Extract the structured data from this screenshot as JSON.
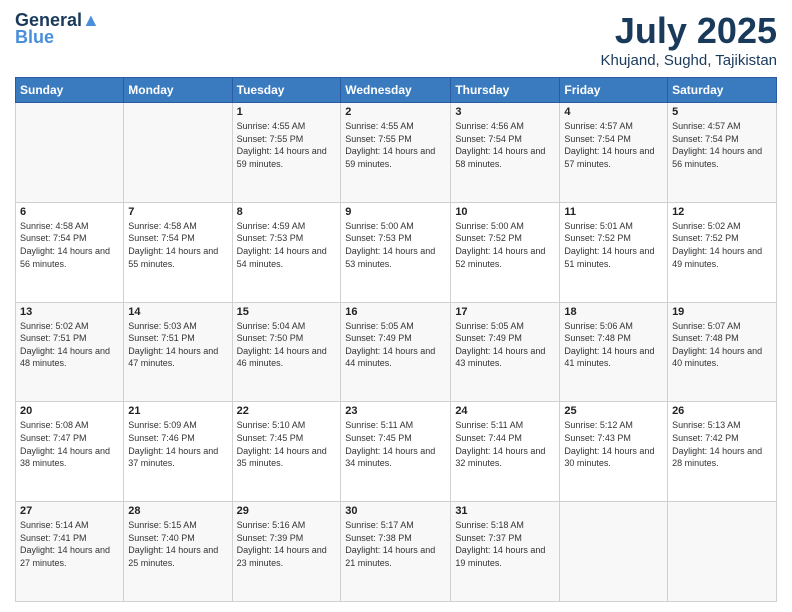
{
  "logo": {
    "general": "General",
    "blue": "Blue"
  },
  "header": {
    "month": "July 2025",
    "location": "Khujand, Sughd, Tajikistan"
  },
  "weekdays": [
    "Sunday",
    "Monday",
    "Tuesday",
    "Wednesday",
    "Thursday",
    "Friday",
    "Saturday"
  ],
  "weeks": [
    [
      {
        "day": "",
        "sunrise": "",
        "sunset": "",
        "daylight": ""
      },
      {
        "day": "",
        "sunrise": "",
        "sunset": "",
        "daylight": ""
      },
      {
        "day": "1",
        "sunrise": "Sunrise: 4:55 AM",
        "sunset": "Sunset: 7:55 PM",
        "daylight": "Daylight: 14 hours and 59 minutes."
      },
      {
        "day": "2",
        "sunrise": "Sunrise: 4:55 AM",
        "sunset": "Sunset: 7:55 PM",
        "daylight": "Daylight: 14 hours and 59 minutes."
      },
      {
        "day": "3",
        "sunrise": "Sunrise: 4:56 AM",
        "sunset": "Sunset: 7:54 PM",
        "daylight": "Daylight: 14 hours and 58 minutes."
      },
      {
        "day": "4",
        "sunrise": "Sunrise: 4:57 AM",
        "sunset": "Sunset: 7:54 PM",
        "daylight": "Daylight: 14 hours and 57 minutes."
      },
      {
        "day": "5",
        "sunrise": "Sunrise: 4:57 AM",
        "sunset": "Sunset: 7:54 PM",
        "daylight": "Daylight: 14 hours and 56 minutes."
      }
    ],
    [
      {
        "day": "6",
        "sunrise": "Sunrise: 4:58 AM",
        "sunset": "Sunset: 7:54 PM",
        "daylight": "Daylight: 14 hours and 56 minutes."
      },
      {
        "day": "7",
        "sunrise": "Sunrise: 4:58 AM",
        "sunset": "Sunset: 7:54 PM",
        "daylight": "Daylight: 14 hours and 55 minutes."
      },
      {
        "day": "8",
        "sunrise": "Sunrise: 4:59 AM",
        "sunset": "Sunset: 7:53 PM",
        "daylight": "Daylight: 14 hours and 54 minutes."
      },
      {
        "day": "9",
        "sunrise": "Sunrise: 5:00 AM",
        "sunset": "Sunset: 7:53 PM",
        "daylight": "Daylight: 14 hours and 53 minutes."
      },
      {
        "day": "10",
        "sunrise": "Sunrise: 5:00 AM",
        "sunset": "Sunset: 7:52 PM",
        "daylight": "Daylight: 14 hours and 52 minutes."
      },
      {
        "day": "11",
        "sunrise": "Sunrise: 5:01 AM",
        "sunset": "Sunset: 7:52 PM",
        "daylight": "Daylight: 14 hours and 51 minutes."
      },
      {
        "day": "12",
        "sunrise": "Sunrise: 5:02 AM",
        "sunset": "Sunset: 7:52 PM",
        "daylight": "Daylight: 14 hours and 49 minutes."
      }
    ],
    [
      {
        "day": "13",
        "sunrise": "Sunrise: 5:02 AM",
        "sunset": "Sunset: 7:51 PM",
        "daylight": "Daylight: 14 hours and 48 minutes."
      },
      {
        "day": "14",
        "sunrise": "Sunrise: 5:03 AM",
        "sunset": "Sunset: 7:51 PM",
        "daylight": "Daylight: 14 hours and 47 minutes."
      },
      {
        "day": "15",
        "sunrise": "Sunrise: 5:04 AM",
        "sunset": "Sunset: 7:50 PM",
        "daylight": "Daylight: 14 hours and 46 minutes."
      },
      {
        "day": "16",
        "sunrise": "Sunrise: 5:05 AM",
        "sunset": "Sunset: 7:49 PM",
        "daylight": "Daylight: 14 hours and 44 minutes."
      },
      {
        "day": "17",
        "sunrise": "Sunrise: 5:05 AM",
        "sunset": "Sunset: 7:49 PM",
        "daylight": "Daylight: 14 hours and 43 minutes."
      },
      {
        "day": "18",
        "sunrise": "Sunrise: 5:06 AM",
        "sunset": "Sunset: 7:48 PM",
        "daylight": "Daylight: 14 hours and 41 minutes."
      },
      {
        "day": "19",
        "sunrise": "Sunrise: 5:07 AM",
        "sunset": "Sunset: 7:48 PM",
        "daylight": "Daylight: 14 hours and 40 minutes."
      }
    ],
    [
      {
        "day": "20",
        "sunrise": "Sunrise: 5:08 AM",
        "sunset": "Sunset: 7:47 PM",
        "daylight": "Daylight: 14 hours and 38 minutes."
      },
      {
        "day": "21",
        "sunrise": "Sunrise: 5:09 AM",
        "sunset": "Sunset: 7:46 PM",
        "daylight": "Daylight: 14 hours and 37 minutes."
      },
      {
        "day": "22",
        "sunrise": "Sunrise: 5:10 AM",
        "sunset": "Sunset: 7:45 PM",
        "daylight": "Daylight: 14 hours and 35 minutes."
      },
      {
        "day": "23",
        "sunrise": "Sunrise: 5:11 AM",
        "sunset": "Sunset: 7:45 PM",
        "daylight": "Daylight: 14 hours and 34 minutes."
      },
      {
        "day": "24",
        "sunrise": "Sunrise: 5:11 AM",
        "sunset": "Sunset: 7:44 PM",
        "daylight": "Daylight: 14 hours and 32 minutes."
      },
      {
        "day": "25",
        "sunrise": "Sunrise: 5:12 AM",
        "sunset": "Sunset: 7:43 PM",
        "daylight": "Daylight: 14 hours and 30 minutes."
      },
      {
        "day": "26",
        "sunrise": "Sunrise: 5:13 AM",
        "sunset": "Sunset: 7:42 PM",
        "daylight": "Daylight: 14 hours and 28 minutes."
      }
    ],
    [
      {
        "day": "27",
        "sunrise": "Sunrise: 5:14 AM",
        "sunset": "Sunset: 7:41 PM",
        "daylight": "Daylight: 14 hours and 27 minutes."
      },
      {
        "day": "28",
        "sunrise": "Sunrise: 5:15 AM",
        "sunset": "Sunset: 7:40 PM",
        "daylight": "Daylight: 14 hours and 25 minutes."
      },
      {
        "day": "29",
        "sunrise": "Sunrise: 5:16 AM",
        "sunset": "Sunset: 7:39 PM",
        "daylight": "Daylight: 14 hours and 23 minutes."
      },
      {
        "day": "30",
        "sunrise": "Sunrise: 5:17 AM",
        "sunset": "Sunset: 7:38 PM",
        "daylight": "Daylight: 14 hours and 21 minutes."
      },
      {
        "day": "31",
        "sunrise": "Sunrise: 5:18 AM",
        "sunset": "Sunset: 7:37 PM",
        "daylight": "Daylight: 14 hours and 19 minutes."
      },
      {
        "day": "",
        "sunrise": "",
        "sunset": "",
        "daylight": ""
      },
      {
        "day": "",
        "sunrise": "",
        "sunset": "",
        "daylight": ""
      }
    ]
  ]
}
